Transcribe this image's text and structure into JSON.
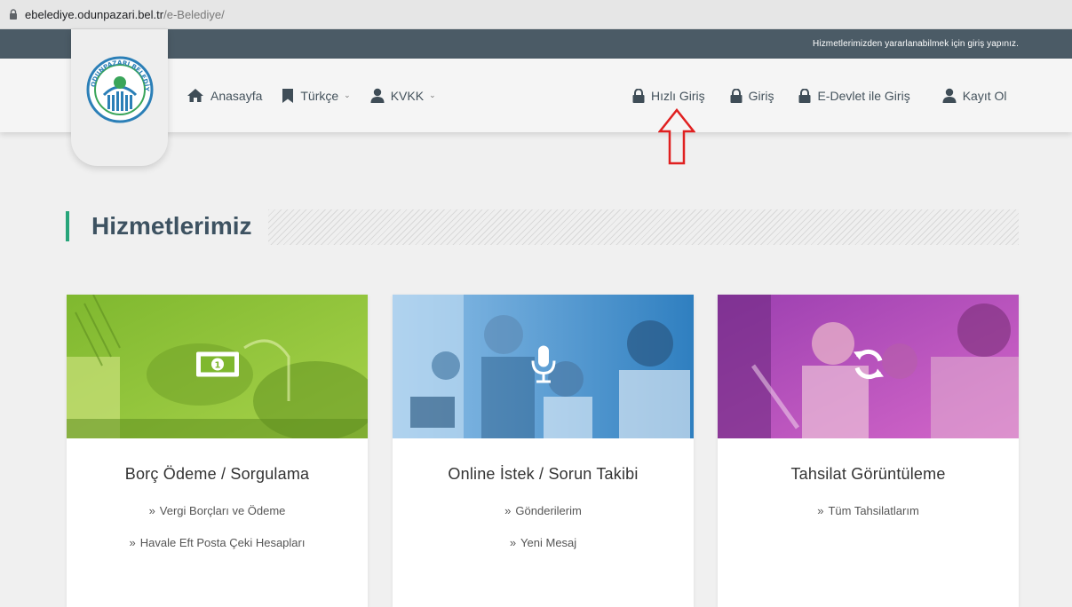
{
  "browser": {
    "url_host": "ebelediye.odunpazari.bel.tr",
    "url_path": "/e-Belediye/"
  },
  "top_strip": {
    "notice": "Hizmetlerimizden yararlanabilmek için giriş yapınız."
  },
  "logo": {
    "text": "ODUNPAZARI BELEDİYESİ",
    "icon": "municipality-logo"
  },
  "nav": {
    "home": {
      "label": "Anasayfa",
      "icon": "home-icon"
    },
    "language": {
      "label": "Türkçe",
      "icon": "bookmark-icon"
    },
    "kvkk": {
      "label": "KVKK",
      "icon": "user-icon"
    },
    "quick_login": {
      "label": "Hızlı Giriş",
      "icon": "lock-icon"
    },
    "login": {
      "label": "Giriş",
      "icon": "lock-icon"
    },
    "edevlet": {
      "label": "E-Devlet ile Giriş",
      "icon": "lock-icon"
    },
    "register": {
      "label": "Kayıt Ol",
      "icon": "user-icon"
    }
  },
  "section": {
    "title": "Hizmetlerimiz",
    "accent_color": "#27a57a"
  },
  "cards": [
    {
      "title": "Borç Ödeme / Sorgulama",
      "icon": "money-bill-icon",
      "tint": "#8dc63f",
      "links": [
        "Vergi Borçları ve Ödeme",
        "Havale Eft Posta Çeki Hesapları"
      ]
    },
    {
      "title": "Online İstek / Sorun Takibi",
      "icon": "microphone-icon",
      "tint": "#3f8fcf",
      "links": [
        "Gönderilerim",
        "Yeni Mesaj"
      ]
    },
    {
      "title": "Tahsilat Görüntüleme",
      "icon": "refresh-icon",
      "tint": "#b24fbf",
      "links": [
        "Tüm Tahsilatlarım"
      ]
    }
  ],
  "annotation": {
    "icon": "red-up-arrow-icon",
    "color": "#e02020"
  }
}
